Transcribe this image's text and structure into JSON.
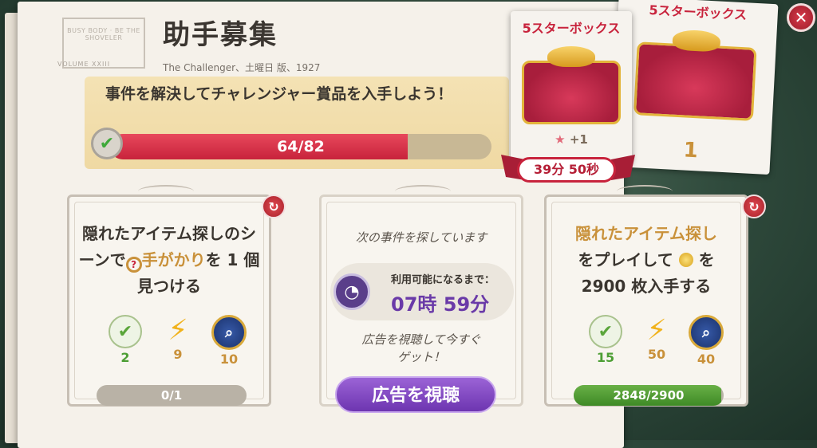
{
  "header": {
    "title": "助手募集",
    "byline": "The Challenger、土曜日 版、1927",
    "stamp_text": "BUSY BODY · BE THE SHOVELER",
    "stamp_bottom": "VOLUME XXIII"
  },
  "challenge": {
    "text": "事件を解決してチャレンジャー賞品を入手しよう！",
    "progress_text": "64/82",
    "progress_current": 64,
    "progress_total": 82
  },
  "tasks": [
    {
      "text_before": "隠れたアイテム探しのシーンで",
      "icon": "clue-magnifier-icon",
      "text_accent": "手がかり",
      "text_after": "を 1 個見つける",
      "rewards": [
        {
          "icon": "check-plus-icon",
          "value": "2",
          "color": "#4d9e34"
        },
        {
          "icon": "lightning-icon",
          "value": "9",
          "color": "#c9913a"
        },
        {
          "icon": "magnifier-badge-icon",
          "value": "10",
          "color": "#c9913a"
        }
      ],
      "progress_text": "0/1",
      "progress_fraction": 0
    },
    {
      "line1_accent": "隠れたアイテム探し",
      "line2": "をプレイして",
      "line2_after": "を",
      "line3": "2900 枚入手する",
      "icon": "coin-icon",
      "rewards": [
        {
          "icon": "check-plus-icon",
          "value": "15",
          "color": "#4d9e34"
        },
        {
          "icon": "lightning-icon",
          "value": "50",
          "color": "#c9913a"
        },
        {
          "icon": "magnifier-badge-icon",
          "value": "40",
          "color": "#c9913a"
        }
      ],
      "progress_text": "2848/2900",
      "progress_fraction": 0.982
    }
  ],
  "searching": {
    "status": "次の事件を探しています",
    "available_label": "利用可能になるまで：",
    "timer": "07時 59分",
    "ad_text_line1": "広告を視聴して今すぐ",
    "ad_text_line2": "ゲット！",
    "ad_button": "広告を視聴"
  },
  "boxes": [
    {
      "title": "5スターボックス",
      "bonus": "+1",
      "timer": "39分 50秒"
    },
    {
      "title": "5スターボックス",
      "count": "1"
    }
  ],
  "colors": {
    "accent_red": "#c8233c",
    "gold": "#c9913a",
    "green": "#4d9e34",
    "purple": "#7a43c0"
  },
  "close_icon": "close-icon"
}
